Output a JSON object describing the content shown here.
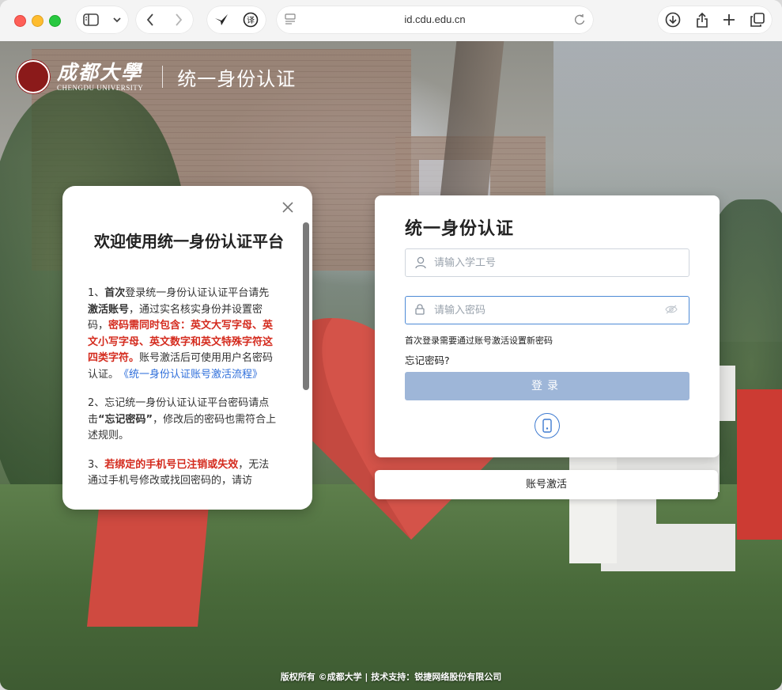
{
  "browser": {
    "url": "id.cdu.edu.cn"
  },
  "header": {
    "school_cn": "成都大學",
    "school_en": "CHENGDU UNIVERSITY",
    "system_title": "统一身份认证"
  },
  "notice": {
    "title": "欢迎使用统一身份认证平台",
    "p1_a": "1、",
    "p1_b": "首次",
    "p1_c": "登录统一身份认证认证平台请先",
    "p1_d": "激活账号",
    "p1_e": "，通过实名核实身份并设置密码，",
    "p1_f": "密码需同时包含：英文大写字母、英文小写字母、英文数字和英文特殊字符这四类字符。",
    "p1_g": "账号激活后可使用用户名密码认证。　",
    "p1_link": "《统一身份认证账号激活流程》",
    "p2_a": "2、忘记统一身份认证认证平台密码请点击",
    "p2_b": "“忘记密码”",
    "p2_c": "，修改后的密码也需符合上述规则。",
    "p3_a": "3、",
    "p3_b": "若绑定的手机号已注销或失效",
    "p3_c": "，无法通过手机号修改或找回密码的，请访"
  },
  "login": {
    "title": "统一身份认证",
    "username_placeholder": "请输入学工号",
    "password_placeholder": "请输入密码",
    "hint": "首次登录需要通过账号激活设置新密码",
    "forgot": "忘记密码?",
    "submit": "登录",
    "activate": "账号激活"
  },
  "footer": {
    "text": "版权所有 ©成都大学 | 技术支持：锐捷网络股份有限公司"
  }
}
